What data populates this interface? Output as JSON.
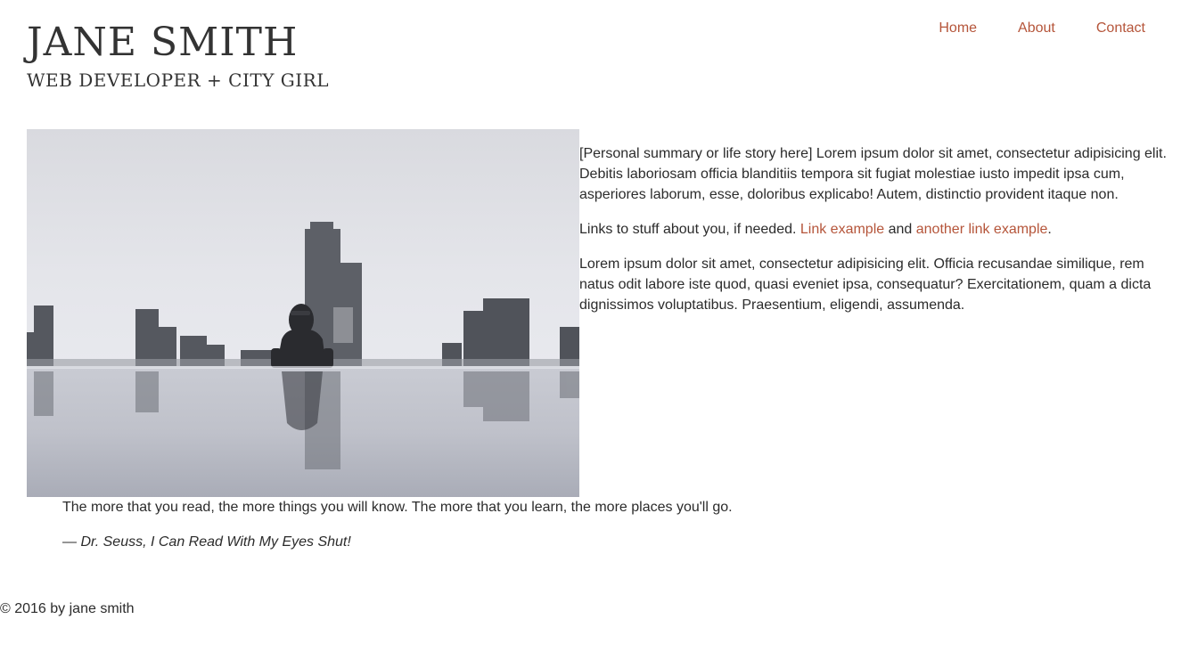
{
  "header": {
    "title": "JANE SMITH",
    "subtitle": "WEB DEVELOPER + CITY GIRL"
  },
  "nav": {
    "items": [
      {
        "label": "Home"
      },
      {
        "label": "About"
      },
      {
        "label": "Contact"
      }
    ]
  },
  "main": {
    "bio": {
      "paragraph1": "[Personal summary or life story here] Lorem ipsum dolor sit amet, consectetur adipisicing elit. Debitis laboriosam officia blanditiis tempora sit fugiat molestiae iusto impedit ipsa cum, asperiores laborum, esse, doloribus explicabo! Autem, distinctio provident itaque non.",
      "links_intro": "Links to stuff about you, if needed. ",
      "link1": "Link example",
      "links_and": " and ",
      "link2": "another link example",
      "links_end": ".",
      "paragraph3": "Lorem ipsum dolor sit amet, consectetur adipisicing elit. Officia recusandae similique, rem natus odit labore iste quod, quasi eveniet ipsa, consequatur? Exercitationem, quam a dicta dignissimos voluptatibus. Praesentium, eligendi, assumenda."
    },
    "quote": {
      "text": "The more that you read, the more things you will know. The more that you learn, the more places you'll go.",
      "citation": "— Dr. Seuss, I Can Read With My Eyes Shut!"
    }
  },
  "footer": {
    "text": "© 2016 by jane smith"
  },
  "colors": {
    "accent": "#b5553a",
    "text": "#2b2b2b"
  }
}
